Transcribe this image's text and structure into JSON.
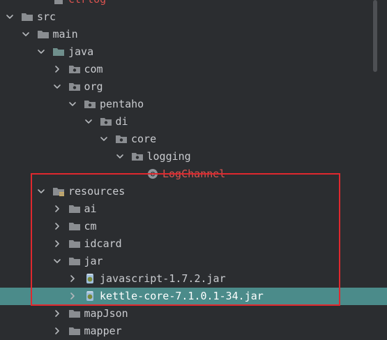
{
  "project_tree": {
    "rows": [
      {
        "label": "ctrlog",
        "type": "file-error",
        "depth": 2,
        "expanded": null,
        "error": true
      },
      {
        "label": "src",
        "type": "folder",
        "depth": 0,
        "expanded": true
      },
      {
        "label": "main",
        "type": "folder",
        "depth": 1,
        "expanded": true
      },
      {
        "label": "java",
        "type": "source-folder",
        "depth": 2,
        "expanded": true
      },
      {
        "label": "com",
        "type": "package",
        "depth": 3,
        "expanded": false
      },
      {
        "label": "org",
        "type": "package",
        "depth": 3,
        "expanded": true
      },
      {
        "label": "pentaho",
        "type": "package",
        "depth": 4,
        "expanded": true
      },
      {
        "label": "di",
        "type": "package",
        "depth": 5,
        "expanded": true
      },
      {
        "label": "core",
        "type": "package",
        "depth": 6,
        "expanded": true
      },
      {
        "label": "logging",
        "type": "package",
        "depth": 7,
        "expanded": true
      },
      {
        "label": "LogChannel",
        "type": "class-error",
        "depth": 8,
        "expanded": null,
        "error": true
      },
      {
        "label": "resources",
        "type": "resources-folder",
        "depth": 2,
        "expanded": true
      },
      {
        "label": "ai",
        "type": "folder",
        "depth": 3,
        "expanded": false
      },
      {
        "label": "cm",
        "type": "folder",
        "depth": 3,
        "expanded": false
      },
      {
        "label": "idcard",
        "type": "folder",
        "depth": 3,
        "expanded": false
      },
      {
        "label": "jar",
        "type": "folder",
        "depth": 3,
        "expanded": true
      },
      {
        "label": "javascript-1.7.2.jar",
        "type": "jar",
        "depth": 4,
        "expanded": false
      },
      {
        "label": "kettle-core-7.1.0.1-34.jar",
        "type": "jar",
        "depth": 4,
        "expanded": false,
        "selected": true
      },
      {
        "label": "mapJson",
        "type": "folder",
        "depth": 3,
        "expanded": false
      },
      {
        "label": "mapper",
        "type": "folder",
        "depth": 3,
        "expanded": false
      }
    ]
  },
  "colors": {
    "background": "#2b2d30",
    "selection": "#4b8b8a",
    "error_text": "#d9534f",
    "folder": "#8a8d91",
    "annotation_box": "#e0282e"
  }
}
